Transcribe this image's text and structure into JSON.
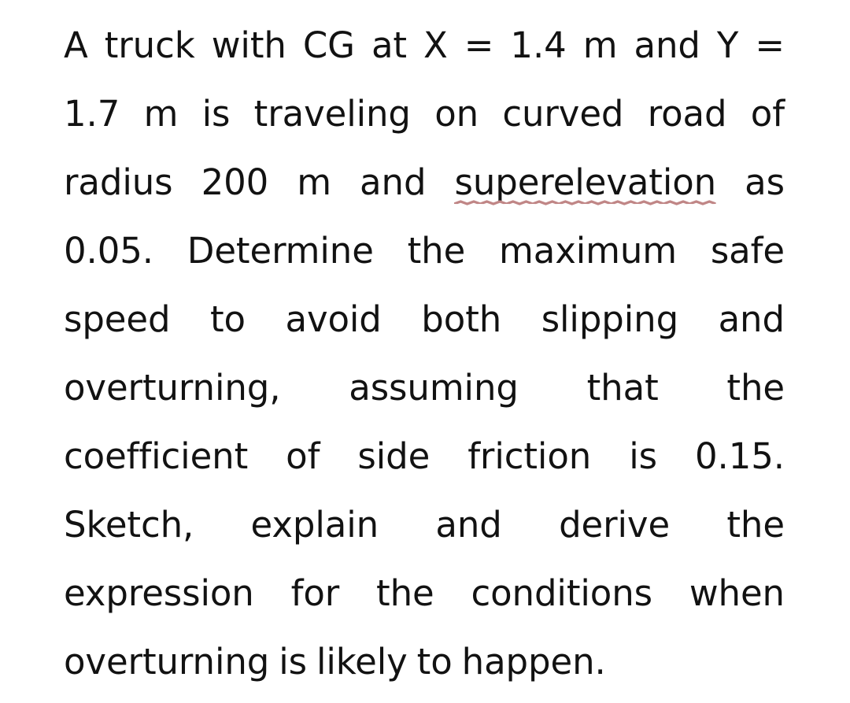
{
  "document": {
    "background_color": "#ffffff",
    "text_color": "#121212",
    "spellcheck_underline_color": "#c08686",
    "alignment": "justified",
    "paragraph": "A truck with CG at X = 1.4 m and Y = 1.7 m is traveling on curved road of radius 200 m and superelevation as 0.05. Determine the maximum safe speed to avoid both slipping and overturning, assuming that the coefficient of side friction is 0.15. Sketch, explain and derive the expression for the conditions when overturning is likely to happen.",
    "misspelled_words": [
      "superelevation"
    ],
    "values": {
      "cg_x": "1.4 m",
      "cg_y": "1.7 m",
      "radius": "200 m",
      "superelevation": "0.05",
      "side_friction_coefficient": "0.15"
    },
    "lines": [
      {
        "index": 1,
        "align": "natural",
        "words": [
          "A",
          "truck",
          "with",
          "CG",
          "at",
          "X",
          "=",
          "1.4",
          "m",
          "and",
          "Y",
          "="
        ]
      },
      {
        "index": 2,
        "align": "natural",
        "words": [
          "1.7",
          "m",
          "is",
          "traveling",
          "on",
          "curved",
          "road",
          "of"
        ]
      },
      {
        "index": 3,
        "align": "natural",
        "words": [
          "radius",
          "200",
          "m",
          "and",
          "superelevation",
          "as"
        ]
      },
      {
        "index": 4,
        "align": "natural",
        "words": [
          "0.05.",
          "Determine",
          "the",
          "maximum",
          "safe"
        ]
      },
      {
        "index": 5,
        "align": "justify",
        "words": [
          "speed",
          "to",
          "avoid",
          "both",
          "slipping",
          "and"
        ]
      },
      {
        "index": 6,
        "align": "justify",
        "words": [
          "overturning,",
          "assuming",
          "that",
          "the"
        ]
      },
      {
        "index": 7,
        "align": "justify",
        "words": [
          "coefficient",
          "of",
          "side",
          "friction",
          "is",
          "0.15."
        ]
      },
      {
        "index": 8,
        "align": "justify",
        "words": [
          "Sketch,",
          "explain",
          "and",
          "derive",
          "the"
        ]
      },
      {
        "index": 9,
        "align": "justify",
        "words": [
          "expression",
          "for",
          "the",
          "conditions",
          "when"
        ]
      },
      {
        "index": 10,
        "align": "flush-left",
        "words": [
          "overturning",
          "is",
          "likely",
          "to",
          "happen."
        ]
      }
    ]
  }
}
